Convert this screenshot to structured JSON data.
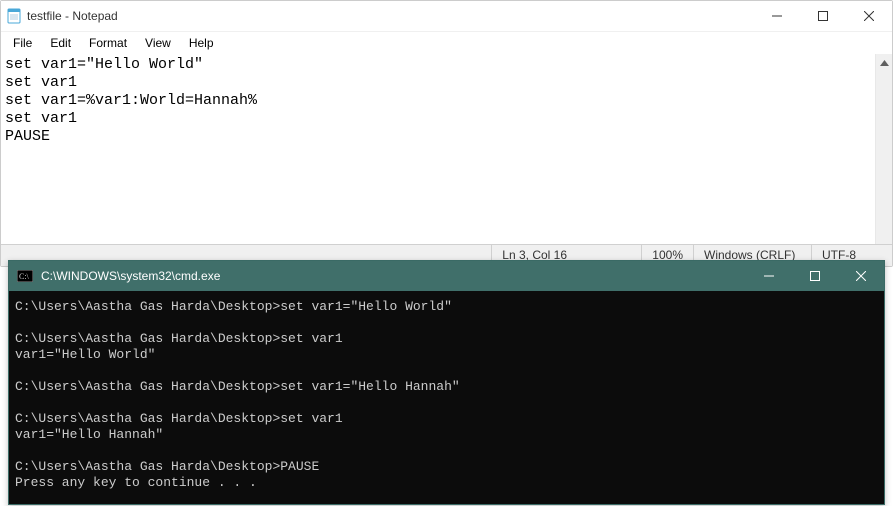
{
  "notepad": {
    "title": "testfile - Notepad",
    "menu": {
      "file": "File",
      "edit": "Edit",
      "format": "Format",
      "view": "View",
      "help": "Help"
    },
    "content": "set var1=\"Hello World\"\nset var1\nset var1=%var1:World=Hannah%\nset var1\nPAUSE",
    "status": {
      "position": "Ln 3, Col 16",
      "zoom": "100%",
      "eol": "Windows (CRLF)",
      "encoding": "UTF-8"
    }
  },
  "cmd": {
    "title": "C:\\WINDOWS\\system32\\cmd.exe",
    "prompt": "C:\\Users\\Aastha Gas Harda\\Desktop>",
    "output": "C:\\Users\\Aastha Gas Harda\\Desktop>set var1=\"Hello World\"\n\nC:\\Users\\Aastha Gas Harda\\Desktop>set var1\nvar1=\"Hello World\"\n\nC:\\Users\\Aastha Gas Harda\\Desktop>set var1=\"Hello Hannah\"\n\nC:\\Users\\Aastha Gas Harda\\Desktop>set var1\nvar1=\"Hello Hannah\"\n\nC:\\Users\\Aastha Gas Harda\\Desktop>PAUSE\nPress any key to continue . . ."
  }
}
